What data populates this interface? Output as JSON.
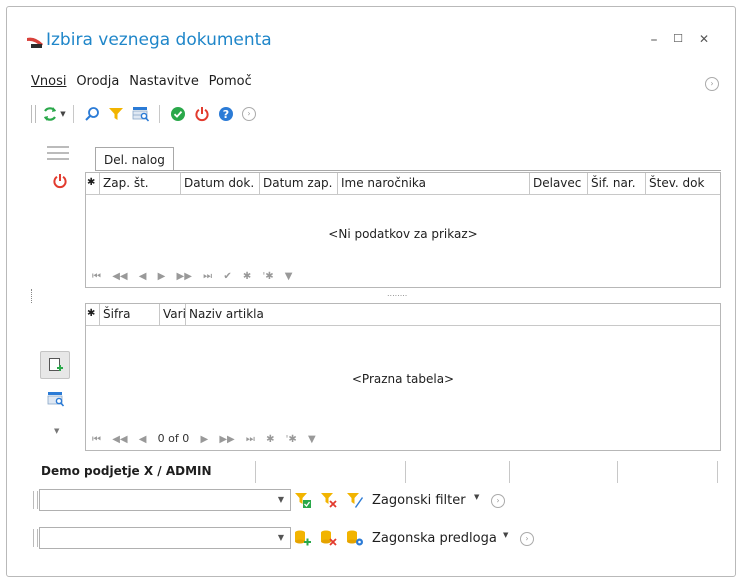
{
  "window": {
    "title": "Izbira veznega dokumenta",
    "minimize": "–",
    "maximize": "☐",
    "close": "✕"
  },
  "menu": {
    "items": [
      "Vnosi",
      "Orodja",
      "Nastavitve",
      "Pomoč"
    ]
  },
  "tab": {
    "label": "Del. nalog"
  },
  "top_grid": {
    "columns": [
      "Zap. št.",
      "Datum dok.",
      "Datum zap.",
      "Ime naročnika",
      "Delavec",
      "Šif. nar.",
      "Štev. dok"
    ],
    "empty_text": "<Ni podatkov za prikaz>",
    "nav": [
      "⏮",
      "◀◀",
      "◀",
      "▶",
      "▶▶",
      "⏭",
      "✔",
      "✱",
      "'✱",
      "▼"
    ]
  },
  "bottom_grid": {
    "columns": [
      "Šifra",
      "Vari",
      "Naziv artikla"
    ],
    "empty_text": "<Prazna tabela>",
    "page_info": "0 of 0",
    "nav_left": [
      "⏮",
      "◀◀",
      "◀"
    ],
    "nav_right": [
      "▶",
      "▶▶",
      "⏭",
      "✱",
      "'✱",
      "▼"
    ]
  },
  "splitter": "........",
  "status": {
    "company_user": "Demo podjetje X / ADMIN"
  },
  "filter_row": {
    "combo_value": "",
    "label": "Zagonski filter"
  },
  "template_row": {
    "combo_value": "",
    "label": "Zagonska predloga"
  },
  "colors": {
    "title": "#1f86c9",
    "refresh": "#2aa84a",
    "power": "#e23b2e",
    "help": "#2b7bd6",
    "filter": "#f2b400"
  }
}
